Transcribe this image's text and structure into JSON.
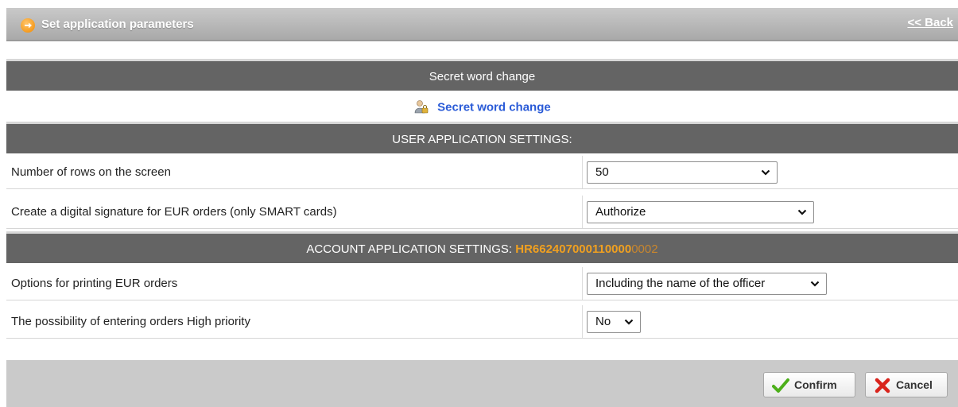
{
  "header": {
    "title": "Set application parameters",
    "back_link": "<< Back"
  },
  "secret_word": {
    "section_title": "Secret word change",
    "link_label": "Secret word change"
  },
  "user_settings": {
    "section_title": "USER APPLICATION SETTINGS:",
    "rows": [
      {
        "label": "Number of rows on the screen",
        "value": "50"
      },
      {
        "label": "Create a digital signature for EUR orders (only SMART cards)",
        "value": "Authorize"
      }
    ]
  },
  "account_settings": {
    "section_title": "ACCOUNT APPLICATION SETTINGS:",
    "account_main": "HR662407000110000",
    "account_suffix": "0002",
    "rows": [
      {
        "label": "Options for printing EUR orders",
        "value": "Including the name of the officer"
      },
      {
        "label": "The possibility of entering orders High priority",
        "value": "No"
      }
    ]
  },
  "footer": {
    "confirm_label": "Confirm",
    "cancel_label": "Cancel"
  },
  "colors": {
    "section_bg": "#646464",
    "accent_orange": "#f0a020",
    "link_blue": "#2a5bd7",
    "confirm_green": "#4caf1a",
    "cancel_red": "#d9241c"
  }
}
